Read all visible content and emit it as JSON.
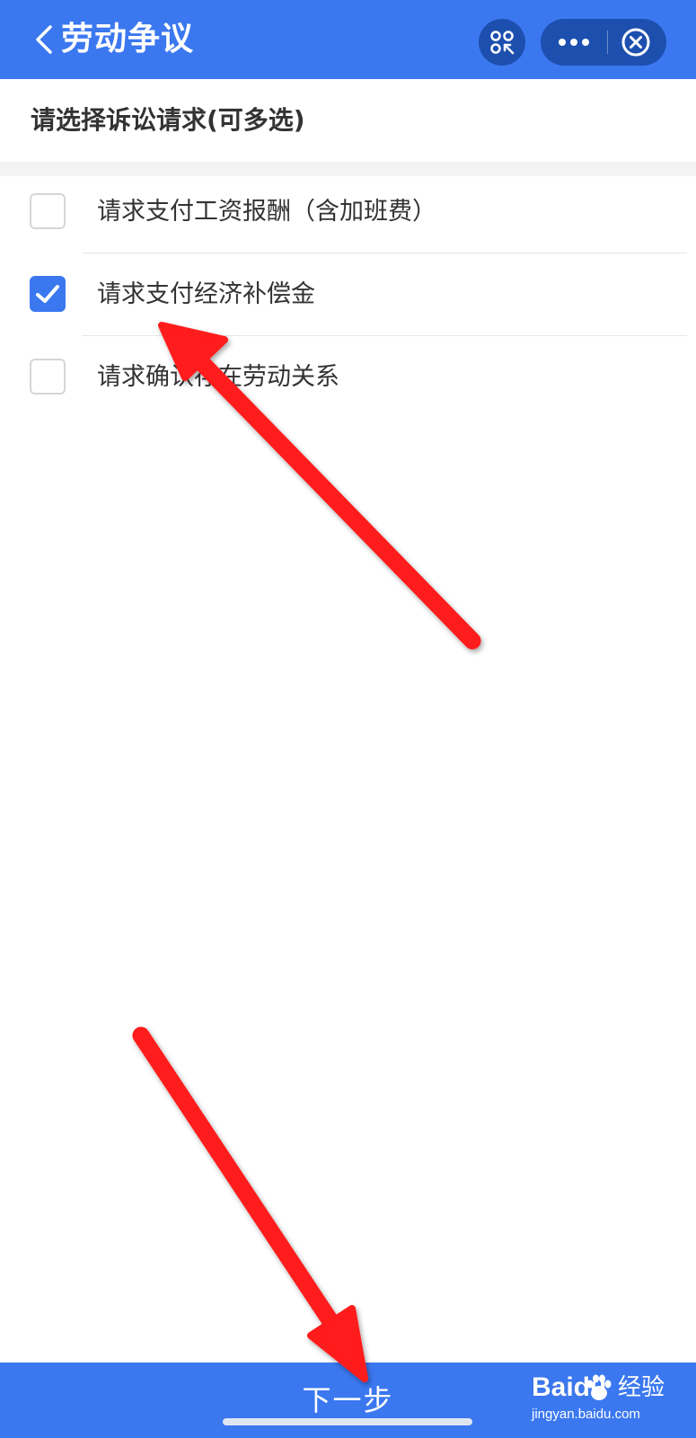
{
  "header": {
    "title": "劳动争议",
    "bg_color": "#3b78f0",
    "capsule_color": "#1d4fae",
    "icons": [
      "chevron-left-icon",
      "scan-icon",
      "more-icon",
      "close-circle-icon"
    ]
  },
  "section_title": "请选择诉讼请求(可多选)",
  "options": [
    {
      "label": "请求支付工资报酬（含加班费）",
      "checked": false
    },
    {
      "label": "请求支付经济补偿金",
      "checked": true
    },
    {
      "label": "请求确认存在劳动关系",
      "checked": false
    }
  ],
  "next_button": {
    "label": "下一步"
  },
  "watermark": {
    "logo": "Baidu",
    "cn": "经验",
    "url": "jingyan.baidu.com"
  },
  "accent_color": "#3b78f0",
  "annotation_color": "#ff1a1a"
}
